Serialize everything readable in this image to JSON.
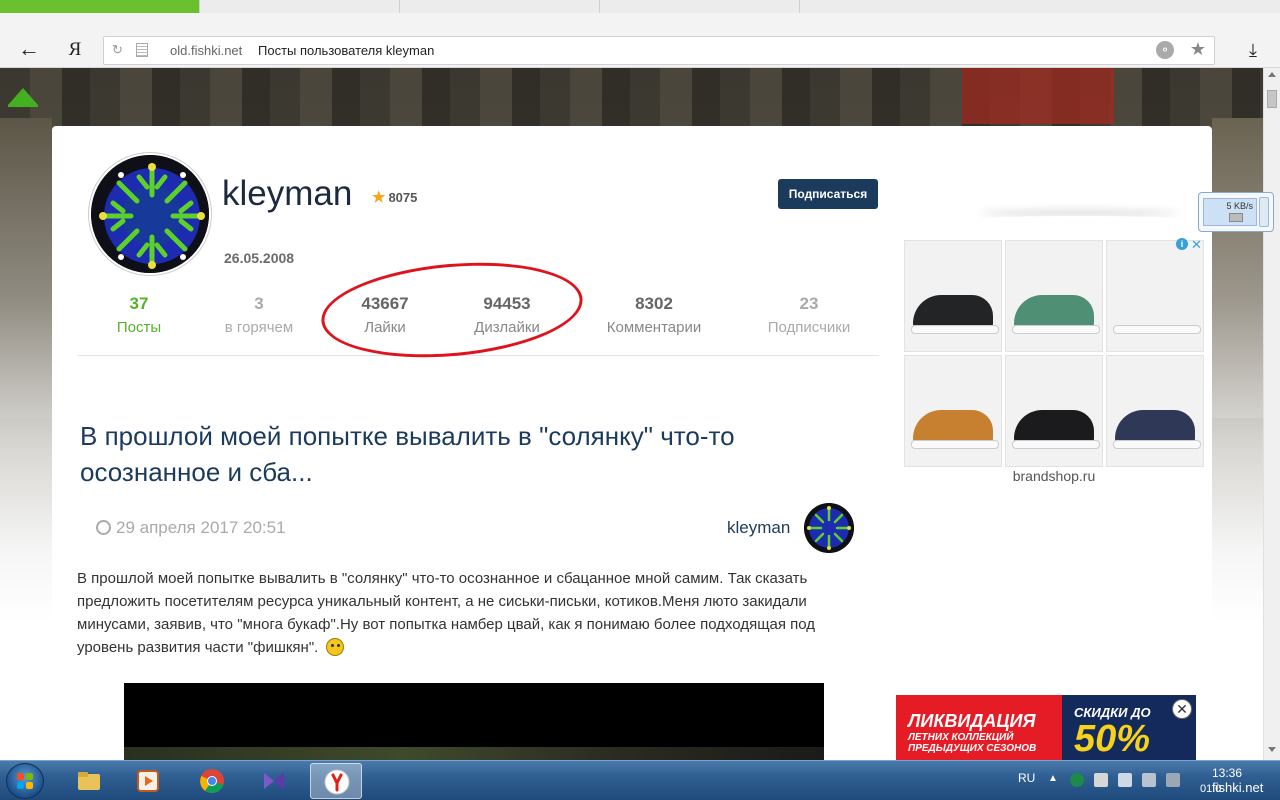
{
  "browser": {
    "url_domain": "old.fishki.net",
    "page_title": "Посты пользователя kleyman",
    "logo": "Я"
  },
  "profile": {
    "username": "kleyman",
    "rating": "8075",
    "subscribe_label": "Подписаться",
    "reg_date": "26.05.2008",
    "stats": [
      {
        "value": "37",
        "label": "Посты"
      },
      {
        "value": "3",
        "label": "в горячем"
      },
      {
        "value": "43667",
        "label": "Лайки"
      },
      {
        "value": "94453",
        "label": "Дизлайки"
      },
      {
        "value": "8302",
        "label": "Комментарии"
      },
      {
        "value": "23",
        "label": "Подписчики"
      }
    ]
  },
  "post": {
    "title": "В прошлой моей попытке вывалить в \"солянку\" что-то осознанное и сба...",
    "date": "29 апреля 2017 20:51",
    "author": "kleyman",
    "body": "В прошлой моей попытке вывалить в \"солянку\" что-то осознанное и сбацанное мной самим. Так сказать предложить посетителям ресурса уникальный контент, а не сиськи-письки, котиков.Меня люто закидали минусами, заявив, что \"многа букаф\".Ну вот попытка намбер цвай, как я понимаю более подходящая под уровень развития части \"фишкян\"."
  },
  "ads": {
    "domain": "brandshop.ru",
    "info_icon": "i",
    "shoe_colors": [
      "#222426",
      "#4f8f73",
      "#f2f2f2",
      "#c6802f",
      "#1b1b1d",
      "#2f3957"
    ],
    "banner": {
      "left_big": "ЛИКВИДАЦИЯ",
      "left_small": "ЛЕТНИХ КОЛЛЕКЦИЙ ПРЕДЫДУЩИХ СЕЗОНОВ",
      "right_small": "СКИДКИ ДО",
      "right_pct": "50%"
    }
  },
  "net_widget": {
    "speed": "5 KB/s"
  },
  "taskbar": {
    "lang": "RU",
    "time": "13:36",
    "date": "01.0"
  },
  "watermark": "fishki.net",
  "colors": {
    "accent_green": "#56b22a",
    "title_blue": "#1c3b5c",
    "subscribe_bg": "#1a3b5c",
    "highlight_red": "#e0121c"
  }
}
